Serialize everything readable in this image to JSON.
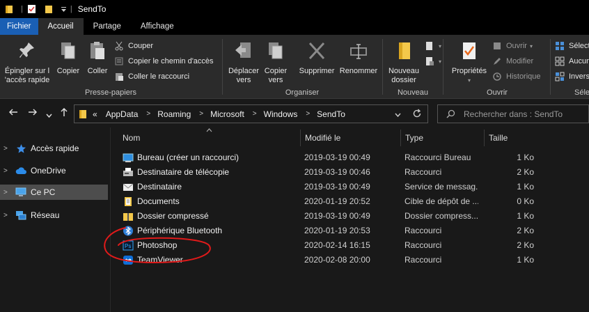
{
  "window": {
    "title": "SendTo"
  },
  "ribbon_tabs": [
    "Fichier",
    "Accueil",
    "Partage",
    "Affichage"
  ],
  "ribbon": {
    "presse_papiers": {
      "label": "Presse-papiers",
      "pin": [
        "Épingler sur l",
        "'accès rapide"
      ],
      "copy": "Copier",
      "paste": "Coller",
      "cut": "Couper",
      "copy_path": "Copier le chemin d'accès",
      "paste_shortcut": "Coller le raccourci"
    },
    "organiser": {
      "label": "Organiser",
      "move_to": [
        "Déplacer",
        "vers"
      ],
      "copy_to": [
        "Copier",
        "vers"
      ],
      "delete": "Supprimer",
      "rename": "Renommer"
    },
    "nouveau": {
      "label": "Nouveau",
      "new_folder": [
        "Nouveau",
        "dossier"
      ]
    },
    "ouvrir": {
      "label": "Ouvrir",
      "properties": "Propriétés",
      "open": "Ouvrir",
      "edit": "Modifier",
      "history": "Historique"
    },
    "selectionner": {
      "label": "Séle",
      "select_all": "Sélect",
      "select_none": "Aucun",
      "invert": "Invers"
    }
  },
  "address": {
    "overflow": "«",
    "crumbs": [
      "AppData",
      "Roaming",
      "Microsoft",
      "Windows",
      "SendTo"
    ]
  },
  "search": {
    "placeholder": "Rechercher dans : SendTo"
  },
  "sidebar": {
    "items": [
      {
        "label": "Accès rapide",
        "icon": "star-icon"
      },
      {
        "label": "OneDrive",
        "icon": "cloud-icon"
      },
      {
        "label": "Ce PC",
        "icon": "computer-icon",
        "selected": true
      },
      {
        "label": "Réseau",
        "icon": "network-icon"
      }
    ]
  },
  "columns": [
    "Nom",
    "Modifié le",
    "Type",
    "Taille"
  ],
  "files": [
    {
      "name": "Bureau (créer un raccourci)",
      "date": "2019-03-19 00:49",
      "type": "Raccourci Bureau",
      "size": "1 Ko",
      "icon": "desktop-icon"
    },
    {
      "name": "Destinataire de télécopie",
      "date": "2019-03-19 00:46",
      "type": "Raccourci",
      "size": "2 Ko",
      "icon": "fax-icon"
    },
    {
      "name": "Destinataire",
      "date": "2019-03-19 00:49",
      "type": "Service de messag...",
      "size": "1 Ko",
      "icon": "mail-icon"
    },
    {
      "name": "Documents",
      "date": "2020-01-19 20:52",
      "type": "Cible de dépôt de ...",
      "size": "0 Ko",
      "icon": "document-icon"
    },
    {
      "name": "Dossier compressé",
      "date": "2019-03-19 00:49",
      "type": "Dossier compress...",
      "size": "1 Ko",
      "icon": "zip-folder-icon"
    },
    {
      "name": "Périphérique Bluetooth",
      "date": "2020-01-19 20:53",
      "type": "Raccourci",
      "size": "2 Ko",
      "icon": "bluetooth-icon"
    },
    {
      "name": "Photoshop",
      "date": "2020-02-14 16:15",
      "type": "Raccourci",
      "size": "2 Ko",
      "icon": "photoshop-icon"
    },
    {
      "name": "TeamViewer",
      "date": "2020-02-08 20:00",
      "type": "Raccourci",
      "size": "1 Ko",
      "icon": "teamviewer-icon"
    }
  ],
  "colors": {
    "accent": "#1a5fb4",
    "annotation": "#e01a1a",
    "folder": "#f4c84a"
  }
}
